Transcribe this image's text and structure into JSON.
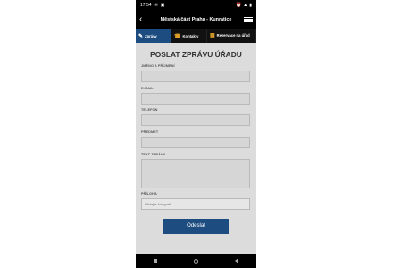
{
  "status_bar": {
    "time": "17:54",
    "left_icons": [
      "message-icon",
      "image-icon"
    ],
    "right_icons": [
      "alarm-icon",
      "signal-icon",
      "battery-icon"
    ]
  },
  "app_bar": {
    "title": "Městská část Praha - Kunratice"
  },
  "tabs": [
    {
      "label": "Zprávy",
      "icon": "chat-icon",
      "active": true
    },
    {
      "label": "Kontakty",
      "icon": "phone-icon",
      "active": false
    },
    {
      "label": "Rezervace na úřad",
      "icon": "calendar-icon",
      "active": false
    }
  ],
  "form": {
    "title": "POSLAT ZPRÁVU ÚŘADU",
    "fields": [
      {
        "label": "JMÉNO A PŘÍJMENÍ",
        "value": ""
      },
      {
        "label": "E-MAIL",
        "value": ""
      },
      {
        "label": "TELEFON",
        "value": ""
      },
      {
        "label": "PŘEDMĚT",
        "value": ""
      },
      {
        "label": "TEXT ZPRÁVY",
        "value": ""
      }
    ],
    "attachment_label": "PŘÍLOHA",
    "attachment_placeholder": "Přidejte fotografii",
    "submit_label": "Odeslat"
  },
  "colors": {
    "accent": "#1c4c80",
    "form_background": "#dcdcdc",
    "icon_orange": "#e0a02a"
  }
}
